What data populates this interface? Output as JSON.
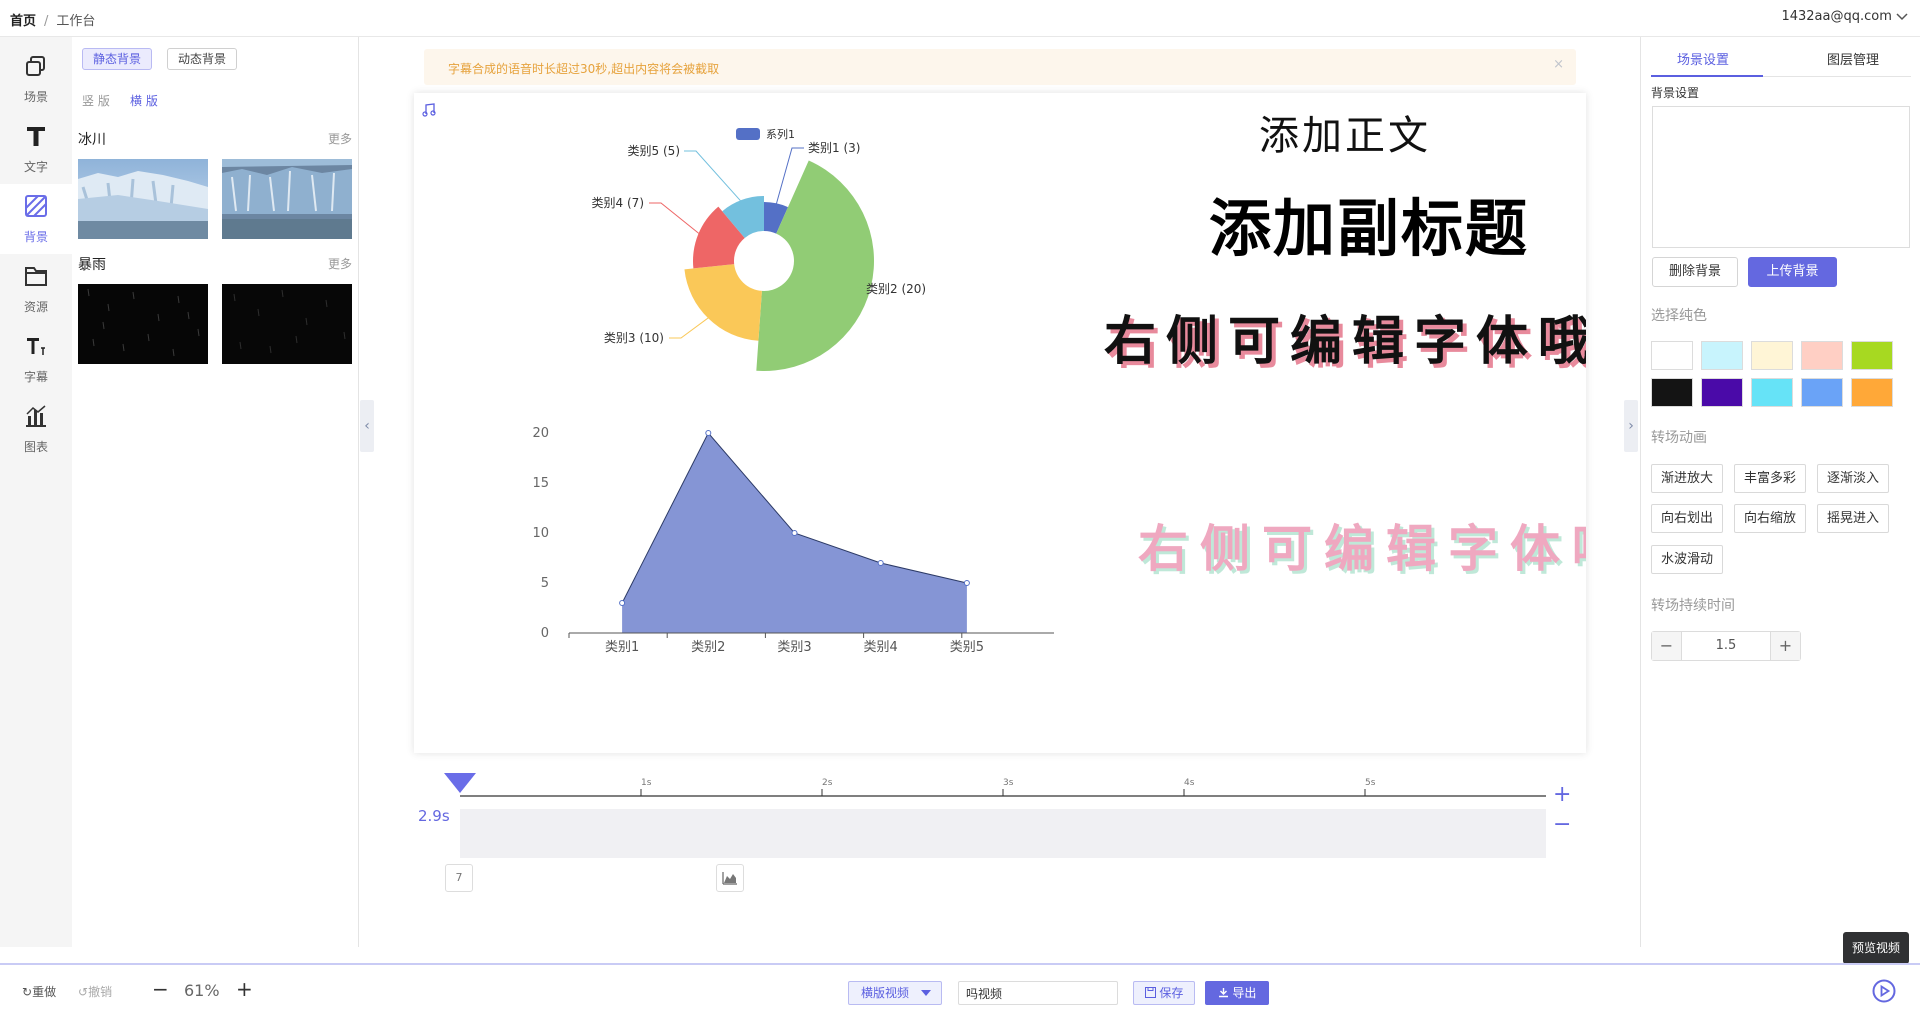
{
  "breadcrumb": {
    "home": "首页",
    "separator": "/",
    "current": "工作台"
  },
  "user": {
    "email": "1432aa@qq.com"
  },
  "sidebar": {
    "items": [
      {
        "label": "场景",
        "icon": "copy-icon"
      },
      {
        "label": "文字",
        "icon": "text-icon"
      },
      {
        "label": "背景",
        "icon": "background-icon"
      },
      {
        "label": "资源",
        "icon": "folder-icon"
      },
      {
        "label": "字幕",
        "icon": "subtitle-icon"
      },
      {
        "label": "图表",
        "icon": "chart-icon"
      }
    ]
  },
  "left_panel": {
    "tabs": [
      "静态背景",
      "动态背景"
    ],
    "orientation": [
      "竖 版",
      "横 版"
    ],
    "sections": [
      {
        "title": "冰川",
        "more": "更多"
      },
      {
        "title": "暴雨",
        "more": "更多"
      }
    ]
  },
  "notice": {
    "text": "字幕合成的语音时长超过30秒,超出内容将会被截取",
    "close": "×"
  },
  "canvas": {
    "title": "添加正文",
    "subtitle": "添加副标题",
    "styled_text": "右侧可编辑字体哦",
    "gradient_text": "右侧可编辑字体哦"
  },
  "chart_data": [
    {
      "type": "pie",
      "legend": "系列1",
      "categories": [
        "类别1",
        "类别2",
        "类别3",
        "类别4",
        "类别5"
      ],
      "values": [
        3,
        20,
        10,
        7,
        5
      ],
      "labels": [
        "类别1 (3)",
        "类别2 (20)",
        "类别3 (10)",
        "类别4 (7)",
        "类别5 (5)"
      ],
      "colors": [
        "#5470c6",
        "#91cc75",
        "#fac858",
        "#ee6666",
        "#73c0de"
      ]
    },
    {
      "type": "area",
      "categories": [
        "类别1",
        "类别2",
        "类别3",
        "类别4",
        "类别5"
      ],
      "values": [
        3,
        20,
        10,
        7,
        5
      ],
      "ylim": [
        0,
        20
      ],
      "yticks": [
        "0",
        "5",
        "10",
        "15",
        "20"
      ],
      "color": "#8595d5"
    }
  ],
  "timeline": {
    "ticks": [
      "1s",
      "2s",
      "3s",
      "4s",
      "5s"
    ],
    "timecode": "2.9s",
    "clip_label": "7",
    "zoom_in": "+",
    "zoom_out": "−"
  },
  "right_panel": {
    "tabs": [
      "场景设置",
      "图层管理"
    ],
    "bg_label": "背景设置",
    "delete_bg": "删除背景",
    "upload_bg": "上传背景",
    "color_label": "选择纯色",
    "colors": [
      "#ffffff",
      "#c8f4fd",
      "#fff5d6",
      "#ffcfc4",
      "#a7d921",
      "#141414",
      "#4a0aa8",
      "#66e3f7",
      "#6aa3f7",
      "#ffa838"
    ],
    "transition_label": "转场动画",
    "transitions": [
      "渐进放大",
      "丰富多彩",
      "逐渐淡入",
      "向右划出",
      "向右缩放",
      "摇晃进入",
      "水波滑动"
    ],
    "duration_label": "转场持续时间",
    "duration_value": "1.5",
    "minus": "−",
    "plus": "+"
  },
  "bottom_bar": {
    "redo": "重做",
    "undo": "撤销",
    "zoom_minus": "−",
    "zoom": "61%",
    "zoom_plus": "+",
    "format": "横版视频",
    "video_name": "吗视频",
    "save": "保存",
    "export": "导出",
    "preview_tooltip": "预览视频"
  }
}
